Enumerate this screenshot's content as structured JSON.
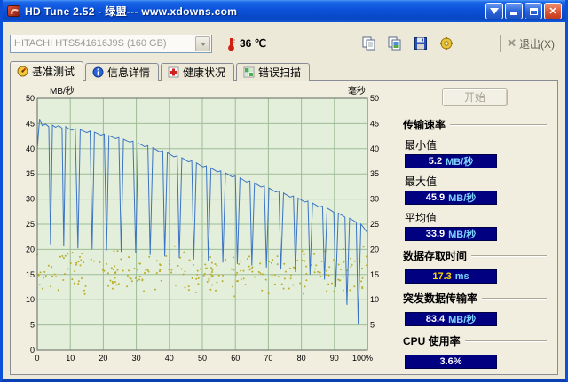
{
  "window": {
    "title": "HD Tune 2.52 - 绿盟--- www.xdowns.com"
  },
  "toolbar": {
    "drive": "HITACHI HTS541616J9S (160 GB)",
    "temperature": "36 ℃",
    "exit_label": "退出(X)"
  },
  "tabs": [
    {
      "label": "基准测试"
    },
    {
      "label": "信息详情"
    },
    {
      "label": "健康状况"
    },
    {
      "label": "错误扫描"
    }
  ],
  "panel": {
    "start_label": "开始"
  },
  "results": {
    "transfer": {
      "heading": "传输速率",
      "items": [
        {
          "label": "最小值",
          "value": "5.2",
          "unit": "MB/秒"
        },
        {
          "label": "最大值",
          "value": "45.9",
          "unit": "MB/秒"
        },
        {
          "label": "平均值",
          "value": "33.9",
          "unit": "MB/秒"
        }
      ]
    },
    "access": {
      "heading": "数据存取时间",
      "value": "17.3",
      "unit": "ms"
    },
    "burst": {
      "heading": "突发数据传输率",
      "value": "83.4",
      "unit": "MB/秒"
    },
    "cpu": {
      "heading": "CPU 使用率",
      "value": "3.6%"
    }
  },
  "chart_data": {
    "type": "line",
    "title": "HD Tune benchmark graph",
    "ylabel_left": "MB/秒",
    "ylabel_right": "毫秒",
    "y_range": [
      0,
      50
    ],
    "x_range": [
      0,
      100
    ],
    "y_ticks_left": [
      50,
      45,
      40,
      35,
      30,
      25,
      20,
      15,
      10,
      5,
      0
    ],
    "y_ticks_right": [
      50,
      45,
      40,
      35,
      30,
      25,
      20,
      15,
      10,
      5
    ],
    "x_ticks": [
      "0",
      "10",
      "20",
      "30",
      "40",
      "50",
      "60",
      "70",
      "80",
      "90",
      "100%"
    ],
    "grid": true,
    "plot_bg": "#e3efda",
    "grid_color": "#9dbd97",
    "series": [
      {
        "name": "transfer-rate",
        "color": "#3b74c4",
        "points": [
          [
            0,
            40
          ],
          [
            0.7,
            45.9
          ],
          [
            1.5,
            44.6
          ],
          [
            2.5,
            44.9
          ],
          [
            3.5,
            44.4
          ],
          [
            4,
            21
          ],
          [
            4.6,
            44.7
          ],
          [
            5.5,
            44.3
          ],
          [
            6.5,
            44.6
          ],
          [
            7.5,
            44.1
          ],
          [
            8,
            20.6
          ],
          [
            8.6,
            44.4
          ],
          [
            9.5,
            44.0
          ],
          [
            10.5,
            43.7
          ],
          [
            11.5,
            44.0
          ],
          [
            12.3,
            20.2
          ],
          [
            13,
            43.8
          ],
          [
            14,
            43.5
          ],
          [
            15,
            43.2
          ],
          [
            16,
            43.5
          ],
          [
            16.6,
            20.0
          ],
          [
            17.3,
            43.3
          ],
          [
            18.3,
            43.0
          ],
          [
            19.3,
            42.7
          ],
          [
            20.3,
            42.9
          ],
          [
            21,
            19.8
          ],
          [
            21.7,
            42.6
          ],
          [
            22.7,
            42.3
          ],
          [
            23.7,
            42.0
          ],
          [
            24.7,
            42.2
          ],
          [
            25.4,
            19.5
          ],
          [
            26.1,
            41.9
          ],
          [
            27,
            41.6
          ],
          [
            28,
            41.3
          ],
          [
            29,
            41.5
          ],
          [
            29.8,
            19.2
          ],
          [
            30.5,
            41.1
          ],
          [
            31.5,
            40.8
          ],
          [
            32.5,
            40.4
          ],
          [
            33.5,
            40.6
          ],
          [
            34.2,
            18.9
          ],
          [
            35,
            40.2
          ],
          [
            36,
            39.8
          ],
          [
            37,
            39.4
          ],
          [
            38,
            39.6
          ],
          [
            38.6,
            18.6
          ],
          [
            39.4,
            39.2
          ],
          [
            40.4,
            38.8
          ],
          [
            41.4,
            38.4
          ],
          [
            42.4,
            38.6
          ],
          [
            43,
            18.3
          ],
          [
            43.8,
            38.2
          ],
          [
            44.8,
            37.8
          ],
          [
            45.8,
            37.4
          ],
          [
            46.8,
            37.6
          ],
          [
            47.4,
            18.0
          ],
          [
            48.2,
            37.2
          ],
          [
            49.2,
            36.8
          ],
          [
            50.2,
            36.4
          ],
          [
            51.2,
            36.6
          ],
          [
            51.8,
            17.7
          ],
          [
            52.6,
            36.2
          ],
          [
            53.6,
            35.8
          ],
          [
            54.6,
            35.4
          ],
          [
            55.6,
            35.6
          ],
          [
            56.2,
            17.4
          ],
          [
            57,
            35.2
          ],
          [
            58,
            34.8
          ],
          [
            59,
            34.4
          ],
          [
            60,
            34.6
          ],
          [
            60.6,
            17.1
          ],
          [
            61.4,
            34.2
          ],
          [
            62.4,
            33.8
          ],
          [
            63.4,
            33.4
          ],
          [
            64.4,
            33.6
          ],
          [
            65,
            16.8
          ],
          [
            65.8,
            33.2
          ],
          [
            66.8,
            32.8
          ],
          [
            67.8,
            32.4
          ],
          [
            68.8,
            32.6
          ],
          [
            69.4,
            16.4
          ],
          [
            70.2,
            32.2
          ],
          [
            71.2,
            31.8
          ],
          [
            72.2,
            31.4
          ],
          [
            73.2,
            31.6
          ],
          [
            73.8,
            16.0
          ],
          [
            74.6,
            31.2
          ],
          [
            75.6,
            30.8
          ],
          [
            76.6,
            30.4
          ],
          [
            77.6,
            30.6
          ],
          [
            78.2,
            15.5
          ],
          [
            79,
            30.2
          ],
          [
            80,
            29.8
          ],
          [
            81,
            29.4
          ],
          [
            82,
            29.6
          ],
          [
            82.6,
            15.0
          ],
          [
            83.4,
            29.2
          ],
          [
            84.4,
            28.8
          ],
          [
            85.4,
            28.4
          ],
          [
            86.4,
            28.6
          ],
          [
            87,
            14.0
          ],
          [
            87.8,
            28.2
          ],
          [
            88.8,
            27.8
          ],
          [
            89.8,
            27.4
          ],
          [
            90.4,
            12.5
          ],
          [
            91.2,
            27.2
          ],
          [
            92.2,
            26.8
          ],
          [
            93.2,
            26.4
          ],
          [
            93.8,
            9.0
          ],
          [
            94.6,
            26.2
          ],
          [
            95.6,
            25.8
          ],
          [
            96.6,
            25.4
          ],
          [
            97.2,
            5.2
          ],
          [
            98,
            25.0
          ],
          [
            99,
            24.2
          ],
          [
            100,
            23.3
          ]
        ]
      },
      {
        "name": "access-time-dots",
        "color": "#b9ad2a",
        "scatter": {
          "seed": 20,
          "count": 270,
          "x_min": 0,
          "x_max": 100,
          "y_min": 10.5,
          "y_max": 20.8
        }
      }
    ]
  },
  "colors": {
    "titlebar_blue": "#0b51d8",
    "window_bg": "#ece9d8",
    "value_box_bg": "#000080",
    "value_text": "#ffffff",
    "unit_text": "#7fd4ff",
    "access_value_text": "#ffd800",
    "line_blue": "#3b74c4",
    "dots_yellow": "#b9ad2a",
    "plot_green": "#e3efda"
  }
}
